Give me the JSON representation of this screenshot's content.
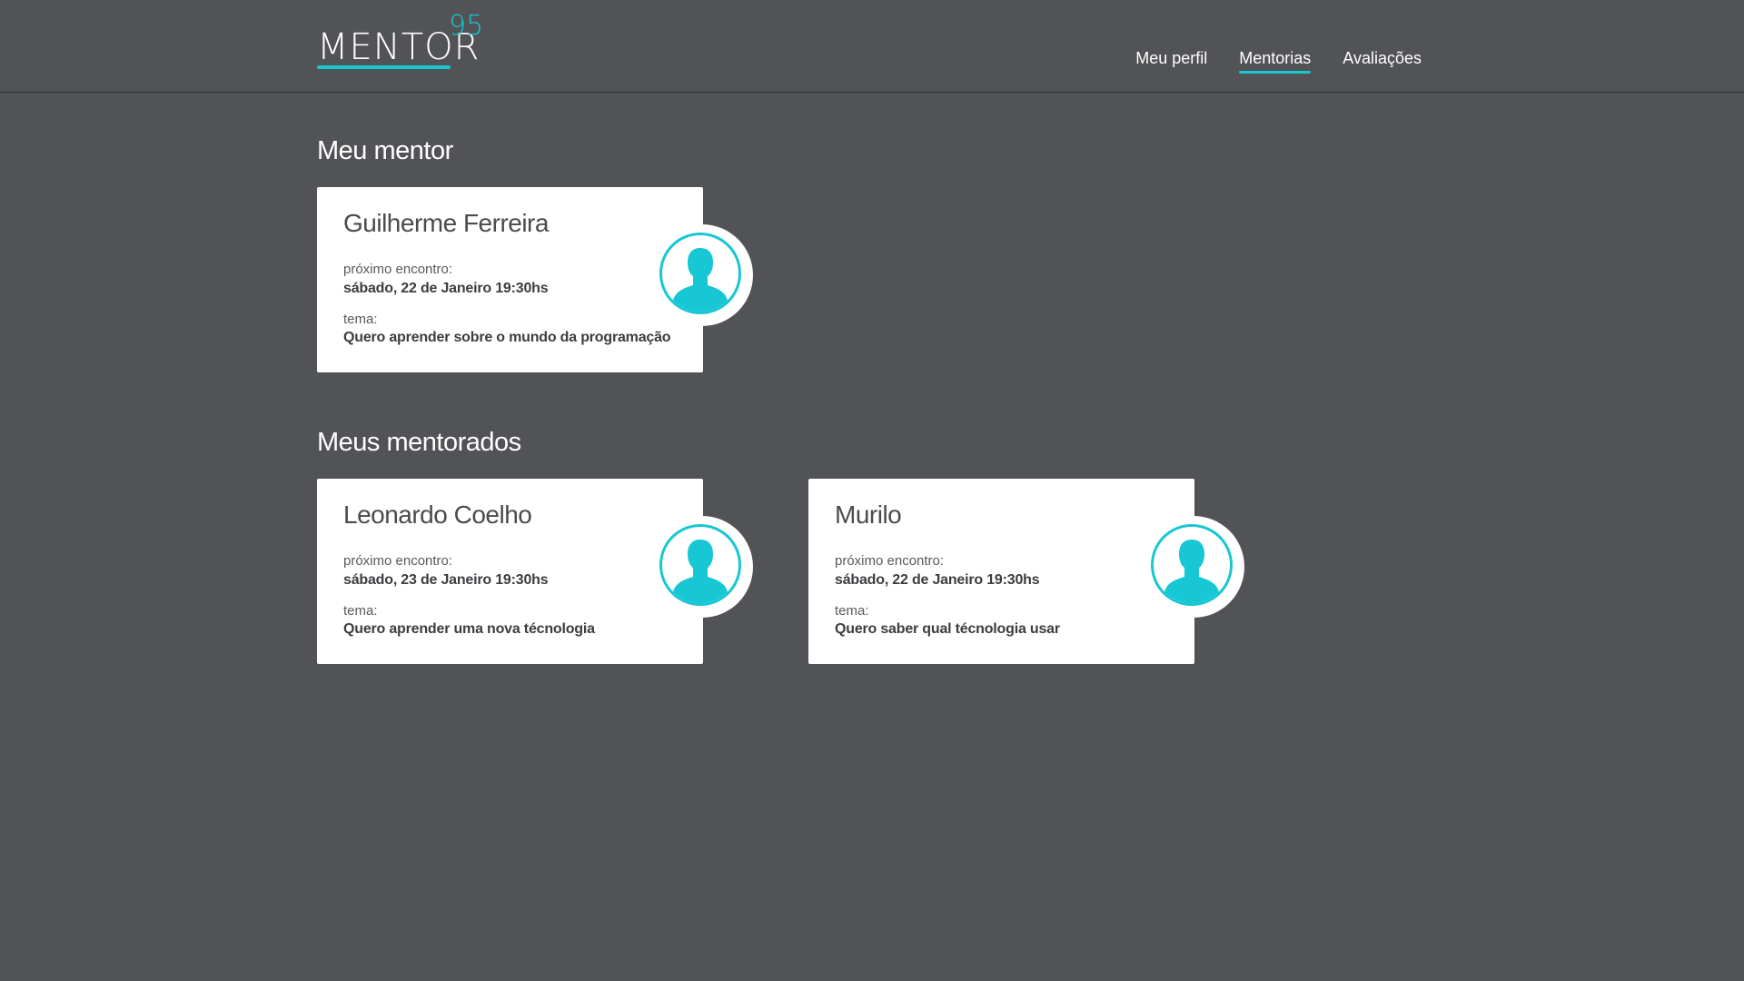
{
  "brand": {
    "name": "MENTOR",
    "superscript": "95",
    "accent_color": "#17c7d3"
  },
  "nav": {
    "items": [
      {
        "label": "Meu perfil",
        "active": false
      },
      {
        "label": "Mentorias",
        "active": true
      },
      {
        "label": "Avaliações",
        "active": false
      }
    ]
  },
  "sections": {
    "mentor_title": "Meu mentor",
    "mentees_title": "Meus mentorados"
  },
  "mentor": {
    "name": "Guilherme Ferreira",
    "next_label": "próximo encontro:",
    "next_value": "sábado, 22 de Janeiro 19:30hs",
    "topic_label": "tema:",
    "topic_value": "Quero aprender sobre o mundo da programação",
    "avatar_icon": "user-silhouette-icon"
  },
  "mentees": [
    {
      "name": "Leonardo Coelho",
      "next_label": "próximo encontro:",
      "next_value": "sábado, 23 de Janeiro 19:30hs",
      "topic_label": "tema:",
      "topic_value": "Quero aprender uma nova técnologia",
      "avatar_icon": "user-silhouette-icon"
    },
    {
      "name": "Murilo",
      "next_label": "próximo encontro:",
      "next_value": "sábado, 22 de Janeiro 19:30hs",
      "topic_label": "tema:",
      "topic_value": "Quero saber qual técnologia usar",
      "avatar_icon": "user-silhouette-icon"
    }
  ],
  "colors": {
    "background": "#525356",
    "card": "#ffffff",
    "accent": "#17c7d3"
  }
}
